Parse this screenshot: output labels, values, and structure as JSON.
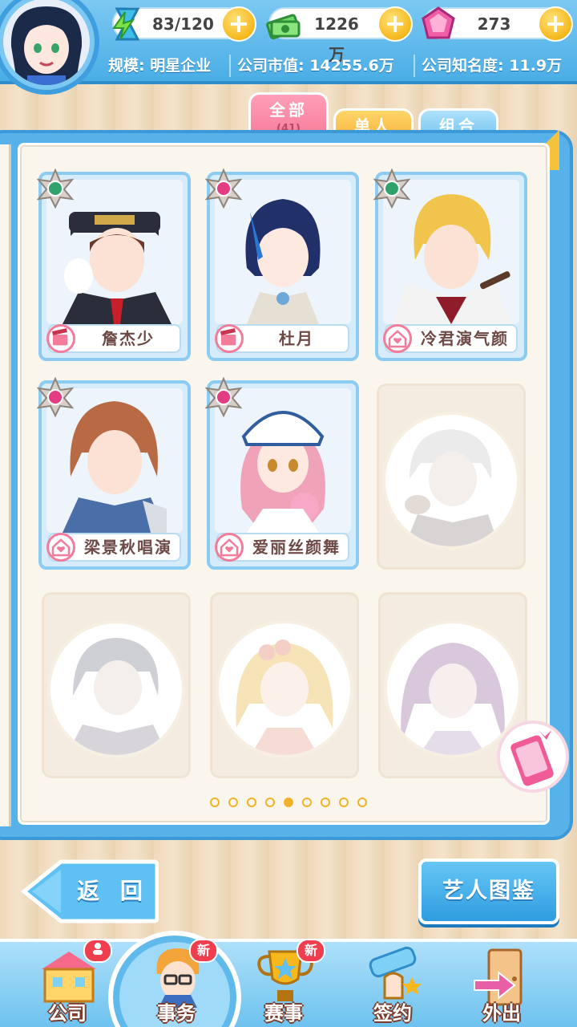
{
  "resources": {
    "stamina": "83/120",
    "money": "1226万",
    "gems": "273"
  },
  "info": {
    "scale": "规模: 明星企业",
    "market_value": "公司市值: 14255.6万",
    "fame": "公司知名度: 11.9万"
  },
  "tabs": {
    "all": "全部",
    "all_count": "(41)",
    "solo": "单人",
    "group": "组合"
  },
  "artists": [
    {
      "name": "詹杰少",
      "type": "film",
      "hair": "#6b3a2a",
      "outfit": "#2b2d3a"
    },
    {
      "name": "杜月",
      "type": "film",
      "hair": "#22306a",
      "outfit": "#e6e0d4"
    },
    {
      "name": "冷君演气颜",
      "type": "idol",
      "hair": "#f1c44c",
      "outfit": "#f3f3f3"
    },
    {
      "name": "梁景秋唱演",
      "type": "idol",
      "hair": "#b86a45",
      "outfit": "#4a6fa8"
    },
    {
      "name": "爱丽丝颜舞",
      "type": "idol",
      "hair": "#f0a2b8",
      "outfit": "#ffffff"
    }
  ],
  "pagination": {
    "total": 9,
    "active": 4
  },
  "buttons": {
    "back": "返 回",
    "encyclopedia": "艺人图鉴"
  },
  "nav": [
    {
      "label": "公司",
      "badge": ""
    },
    {
      "label": "事务",
      "badge": "新"
    },
    {
      "label": "赛事",
      "badge": "新"
    },
    {
      "label": "签约",
      "badge": ""
    },
    {
      "label": "外出",
      "badge": ""
    }
  ],
  "colors": {
    "accent_blue": "#4aaee6",
    "accent_pink": "#f77a98",
    "accent_gold": "#f6b81c"
  }
}
